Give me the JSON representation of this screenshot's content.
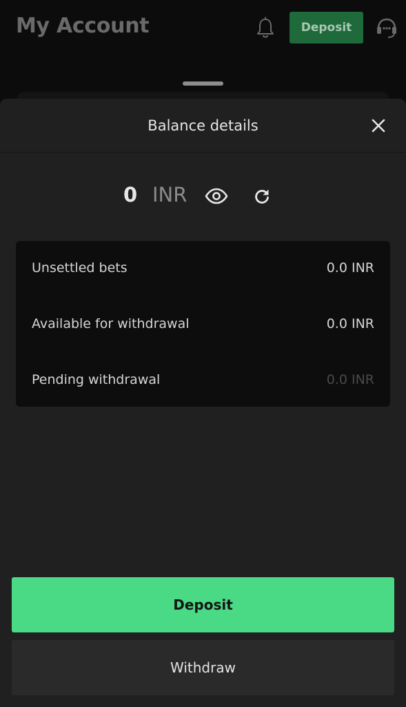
{
  "header": {
    "title": "My Account",
    "deposit_label": "Deposit",
    "icons": {
      "notifications": "bell-icon",
      "support": "headset-icon"
    }
  },
  "sheet": {
    "title": "Balance details",
    "close_icon": "close-icon",
    "balance": {
      "amount": "0",
      "currency": "INR",
      "icons": {
        "visibility": "eye-icon",
        "refresh": "refresh-icon"
      }
    },
    "details": [
      {
        "label": "Unsettled bets",
        "value": "0.0 INR"
      },
      {
        "label": "Available for withdrawal",
        "value": "0.0 INR"
      },
      {
        "label": "Pending withdrawal",
        "value": "0.0 INR"
      }
    ],
    "deposit_label": "Deposit",
    "withdraw_label": "Withdraw"
  },
  "colors": {
    "accent": "#4ad984",
    "header_deposit_bg": "#1f6a3a",
    "sheet_bg": "#202020",
    "card_bg": "#0d0d0d",
    "page_bg": "#0c0c0c"
  }
}
